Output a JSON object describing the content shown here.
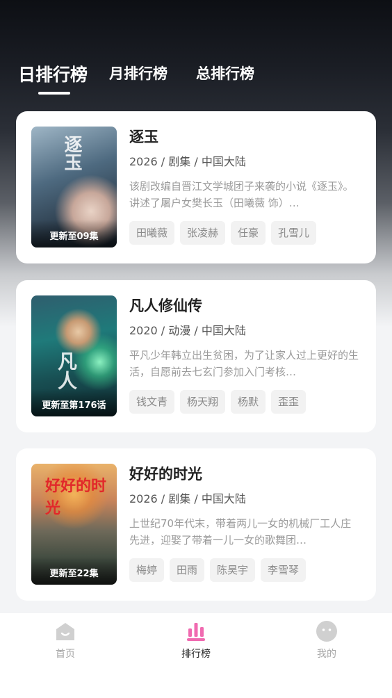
{
  "tabs": [
    {
      "label": "日排行榜"
    },
    {
      "label": "月排行榜"
    },
    {
      "label": "总排行榜"
    }
  ],
  "cards": [
    {
      "poster_text": "逐玉",
      "badge": "更新至09集",
      "title": "逐玉",
      "meta": "2026 / 剧集 / 中国大陆",
      "desc": "该剧改编自晋江文学城团子来袭的小说《逐玉》。讲述了屠户女樊长玉（田曦薇 饰）…",
      "tags": [
        "田曦薇",
        "张凌赫",
        "任豪",
        "孔雪儿"
      ]
    },
    {
      "poster_text": "凡人",
      "badge": "更新至第176话",
      "title": "凡人修仙传",
      "meta": "2020 / 动漫 / 中国大陆",
      "desc": "平凡少年韩立出生贫困，为了让家人过上更好的生活，自愿前去七玄门参加入门考核…",
      "tags": [
        "钱文青",
        "杨天翔",
        "杨默",
        "歪歪"
      ]
    },
    {
      "poster_text": "好好的时光",
      "badge": "更新至22集",
      "title": "好好的时光",
      "meta": "2026 / 剧集 / 中国大陆",
      "desc": "上世纪70年代末，带着两儿一女的机械厂工人庄先进，迎娶了带着一儿一女的歌舞团…",
      "tags": [
        "梅婷",
        "田雨",
        "陈昊宇",
        "李雪琴"
      ]
    }
  ],
  "nav": [
    {
      "label": "首页",
      "icon": "home-icon"
    },
    {
      "label": "排行榜",
      "icon": "ranking-icon"
    },
    {
      "label": "我的",
      "icon": "profile-icon"
    }
  ],
  "colors": {
    "accent": "#f06ab0",
    "nav_inactive": "#d0d0d0"
  }
}
